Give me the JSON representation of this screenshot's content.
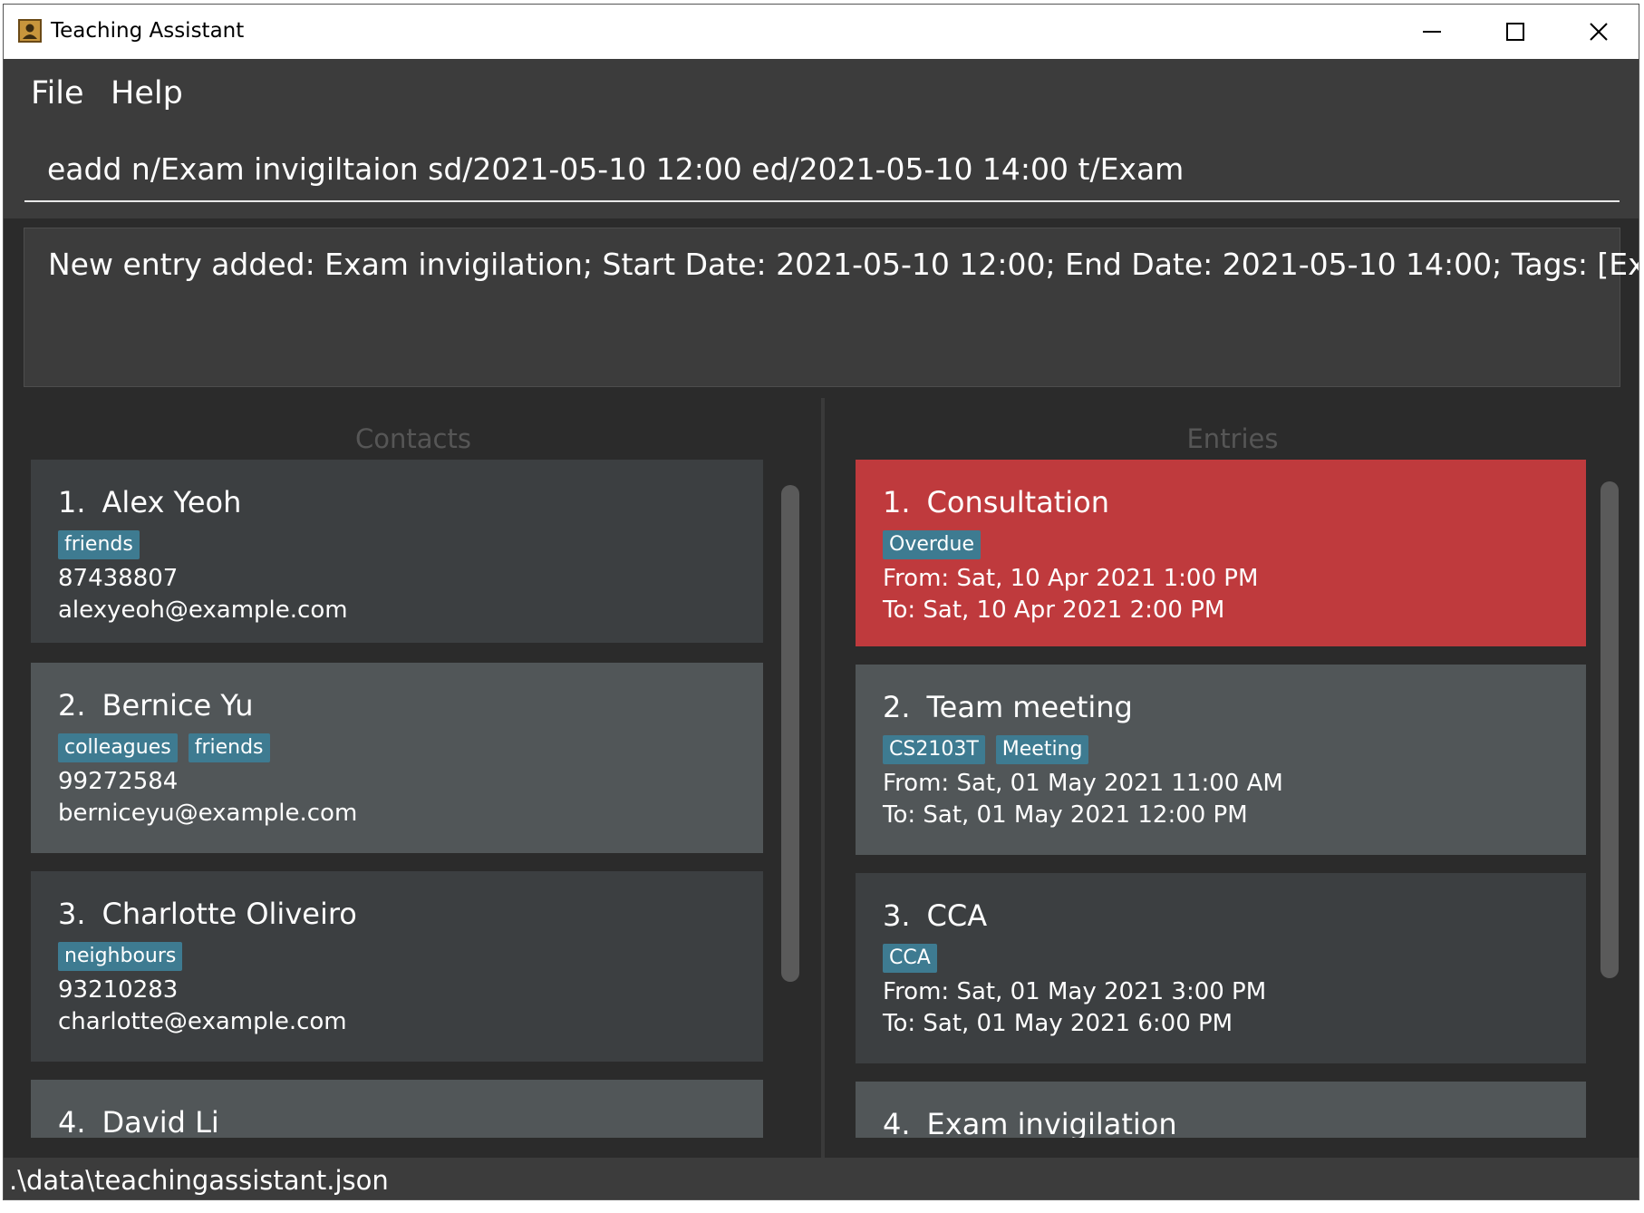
{
  "window": {
    "title": "Teaching Assistant"
  },
  "menu": {
    "file": "File",
    "help": "Help"
  },
  "command": {
    "value": "eadd n/Exam invigiltaion sd/2021-05-10 12:00 ed/2021-05-10 14:00 t/Exam"
  },
  "result": {
    "text": "New entry added: Exam invigilation; Start Date: 2021-05-10 12:00; End Date: 2021-05-10 14:00; Tags: [Exam]"
  },
  "contacts": {
    "title": "Contacts",
    "items": [
      {
        "index": "1.",
        "name": "Alex Yeoh",
        "tags": [
          "friends"
        ],
        "phone": "87438807",
        "email": "alexyeoh@example.com"
      },
      {
        "index": "2.",
        "name": "Bernice Yu",
        "tags": [
          "colleagues",
          "friends"
        ],
        "phone": "99272584",
        "email": "berniceyu@example.com"
      },
      {
        "index": "3.",
        "name": "Charlotte Oliveiro",
        "tags": [
          "neighbours"
        ],
        "phone": "93210283",
        "email": "charlotte@example.com"
      },
      {
        "index": "4.",
        "name": "David Li"
      }
    ]
  },
  "entries": {
    "title": "Entries",
    "items": [
      {
        "index": "1.",
        "name": "Consultation",
        "tags": [
          "Overdue"
        ],
        "from": "From: Sat, 10 Apr 2021 1:00 PM",
        "to": "To: Sat, 10 Apr 2021 2:00 PM"
      },
      {
        "index": "2.",
        "name": "Team meeting",
        "tags": [
          "CS2103T",
          "Meeting"
        ],
        "from": "From: Sat, 01 May 2021 11:00 AM",
        "to": "To: Sat, 01 May 2021 12:00 PM"
      },
      {
        "index": "3.",
        "name": "CCA",
        "tags": [
          "CCA"
        ],
        "from": "From: Sat, 01 May 2021 3:00 PM",
        "to": "To: Sat, 01 May 2021 6:00 PM"
      },
      {
        "index": "4.",
        "name": "Exam invigilation"
      }
    ]
  },
  "status": {
    "path": ".\\data\\teachingassistant.json"
  },
  "colors": {
    "overdue": "#bf3a3d",
    "tag": "#3e7b91",
    "card_dark": "#3c3f41",
    "card_light": "#515658"
  },
  "icons": {
    "app": "app-icon",
    "minimize": "minimize-icon",
    "maximize": "maximize-icon",
    "close": "close-icon"
  }
}
